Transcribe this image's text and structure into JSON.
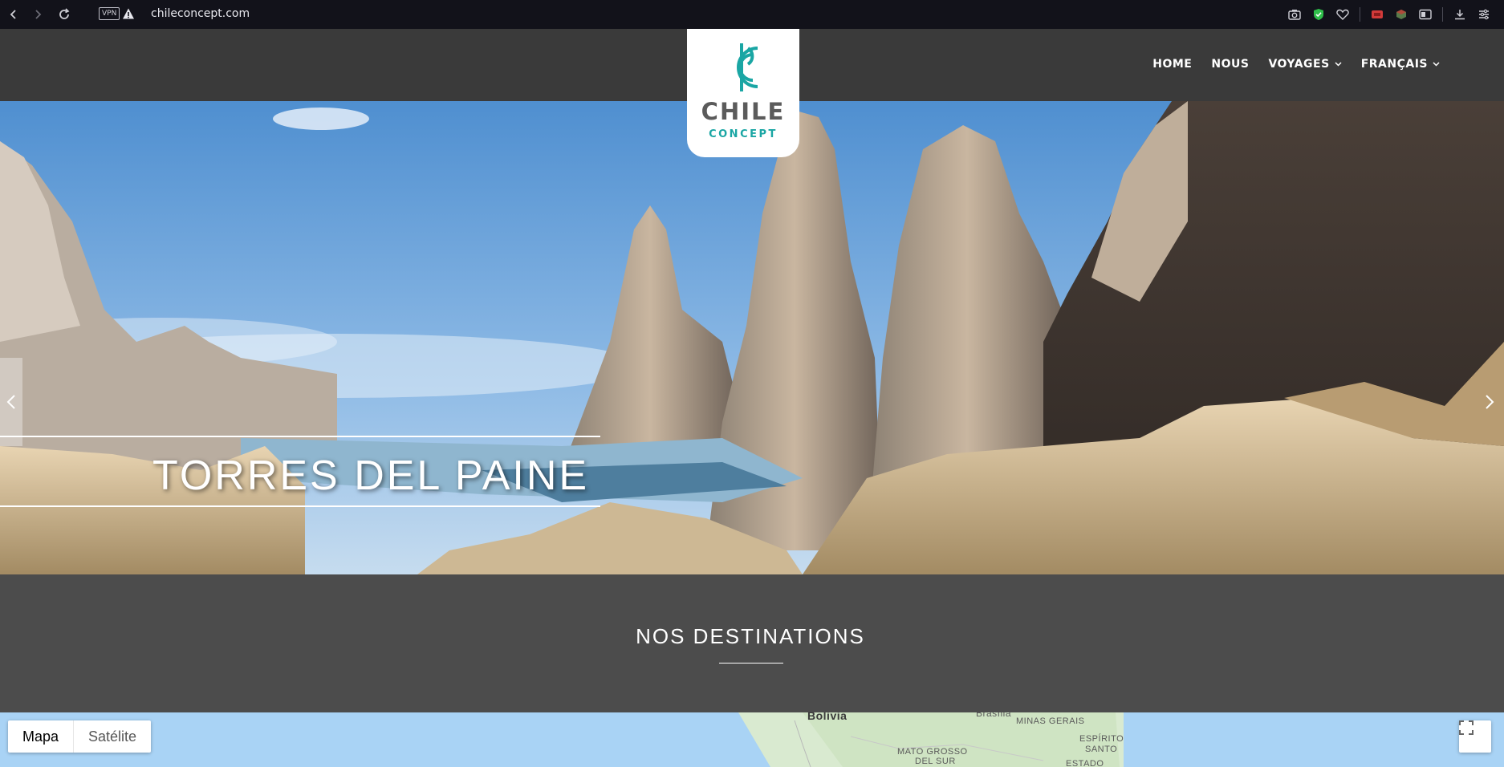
{
  "browser": {
    "url": "chileconcept.com",
    "vpn_label": "VPN"
  },
  "site": {
    "logo_title": "CHILE",
    "logo_sub": "CONCEPT",
    "brand_color": "#1aa6a4",
    "nav": [
      {
        "label": "HOME",
        "has_dropdown": false
      },
      {
        "label": "NOUS",
        "has_dropdown": false
      },
      {
        "label": "VOYAGES",
        "has_dropdown": true
      },
      {
        "label": "FRANÇAIS",
        "has_dropdown": true
      }
    ]
  },
  "hero": {
    "caption": "TORRES DEL PAINE",
    "prev_icon": "chevron-left-icon",
    "next_icon": "chevron-right-icon"
  },
  "destinations": {
    "title": "NOS DESTINATIONS"
  },
  "map": {
    "type_options": [
      "Mapa",
      "Satélite"
    ],
    "selected_type": "Mapa",
    "labels": {
      "bolivia": "Bolivia",
      "brasilia": "Brasília",
      "minas_gerais": "MINAS GERAIS",
      "espirito_santo_1": "ESPÍRITO",
      "espirito_santo_2": "SANTO",
      "mato_grosso_1": "MATO GROSSO",
      "mato_grosso_2": "DEL SUR",
      "estado": "ESTADO"
    }
  }
}
